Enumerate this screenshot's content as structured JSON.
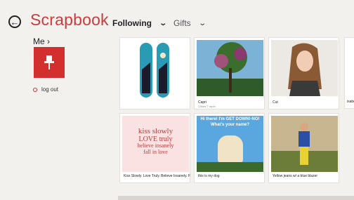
{
  "app": {
    "title": "Scrapbook"
  },
  "nav": {
    "following": "Following",
    "gifts": "Gifts"
  },
  "profile": {
    "me_label": "Me",
    "logout_label": "log out"
  },
  "tiles": [
    {
      "caption": "",
      "sub": ""
    },
    {
      "caption": "Capri",
      "sub": "1 likes 7 repin"
    },
    {
      "caption": "Cut",
      "sub": ""
    },
    {
      "caption": "Kiss Slowly. Love Truly. Believe Insanely. Fall...",
      "sub": ""
    },
    {
      "caption": "this is my dog",
      "sub": ""
    },
    {
      "caption": "Yellow jeans w/ a blue blazer",
      "sub": ""
    }
  ],
  "quote": {
    "line1": "kiss slowly",
    "line2": "LOVE truly",
    "line3": "believe insanely",
    "line4": "fall in love"
  },
  "meme": {
    "top": "Hi there! I'm GET DOWN!-NO!",
    "bottom": "What's your name?"
  },
  "peek_caption": "isabe",
  "colors": {
    "brand": "#cc3b3b",
    "accent": "#d32f2f"
  }
}
